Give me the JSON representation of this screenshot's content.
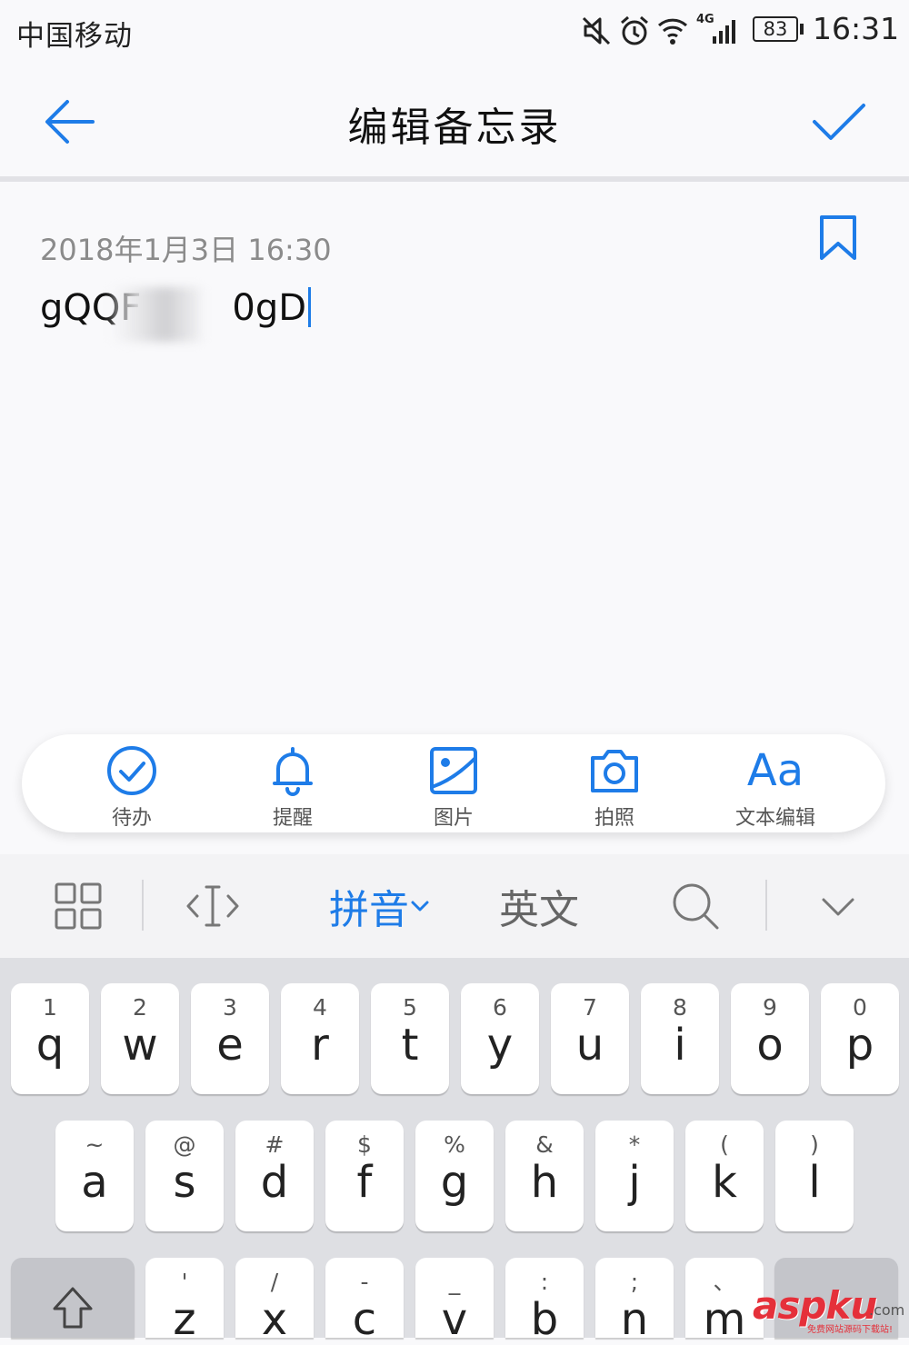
{
  "status_bar": {
    "carrier": "中国移动",
    "network": "4G",
    "battery": "83",
    "time": "16:31"
  },
  "title_bar": {
    "back_icon": "arrow-left-icon",
    "title": "编辑备忘录",
    "confirm_icon": "checkmark-icon"
  },
  "note": {
    "date": "2018年1月3日 16:30",
    "text_before": "gQQF",
    "text_after": "0gD",
    "bookmark_icon": "bookmark-icon"
  },
  "toolbar": {
    "items": [
      {
        "label": "待办",
        "icon": "todo-check-icon"
      },
      {
        "label": "提醒",
        "icon": "bell-icon"
      },
      {
        "label": "图片",
        "icon": "image-icon"
      },
      {
        "label": "拍照",
        "icon": "camera-icon"
      },
      {
        "label": "文本编辑",
        "icon": "text-format-icon",
        "glyph": "Aa"
      }
    ]
  },
  "keyboard": {
    "top_bar": {
      "pinyin": "拼音",
      "english": "英文"
    },
    "row1": [
      {
        "hint": "1",
        "char": "q"
      },
      {
        "hint": "2",
        "char": "w"
      },
      {
        "hint": "3",
        "char": "e"
      },
      {
        "hint": "4",
        "char": "r"
      },
      {
        "hint": "5",
        "char": "t"
      },
      {
        "hint": "6",
        "char": "y"
      },
      {
        "hint": "7",
        "char": "u"
      },
      {
        "hint": "8",
        "char": "i"
      },
      {
        "hint": "9",
        "char": "o"
      },
      {
        "hint": "0",
        "char": "p"
      }
    ],
    "row2": [
      {
        "hint": "~",
        "char": "a"
      },
      {
        "hint": "@",
        "char": "s"
      },
      {
        "hint": "#",
        "char": "d"
      },
      {
        "hint": "$",
        "char": "f"
      },
      {
        "hint": "%",
        "char": "g"
      },
      {
        "hint": "&",
        "char": "h"
      },
      {
        "hint": "*",
        "char": "j"
      },
      {
        "hint": "(",
        "char": "k"
      },
      {
        "hint": ")",
        "char": "l"
      }
    ],
    "row3": [
      {
        "hint": "'",
        "char": "z"
      },
      {
        "hint": "/",
        "char": "x"
      },
      {
        "hint": "-",
        "char": "c"
      },
      {
        "hint": "_",
        "char": "v"
      },
      {
        "hint": ":",
        "char": "b"
      },
      {
        "hint": ";",
        "char": "n"
      },
      {
        "hint": "、",
        "char": "m"
      }
    ]
  },
  "watermark": {
    "main": "aspku",
    "suffix": ".com",
    "sub": "免费网站源码下载站!"
  },
  "colors": {
    "accent": "#1e7ce8",
    "background": "#f9f9fb",
    "keyboard_bg": "#dedfe3"
  }
}
